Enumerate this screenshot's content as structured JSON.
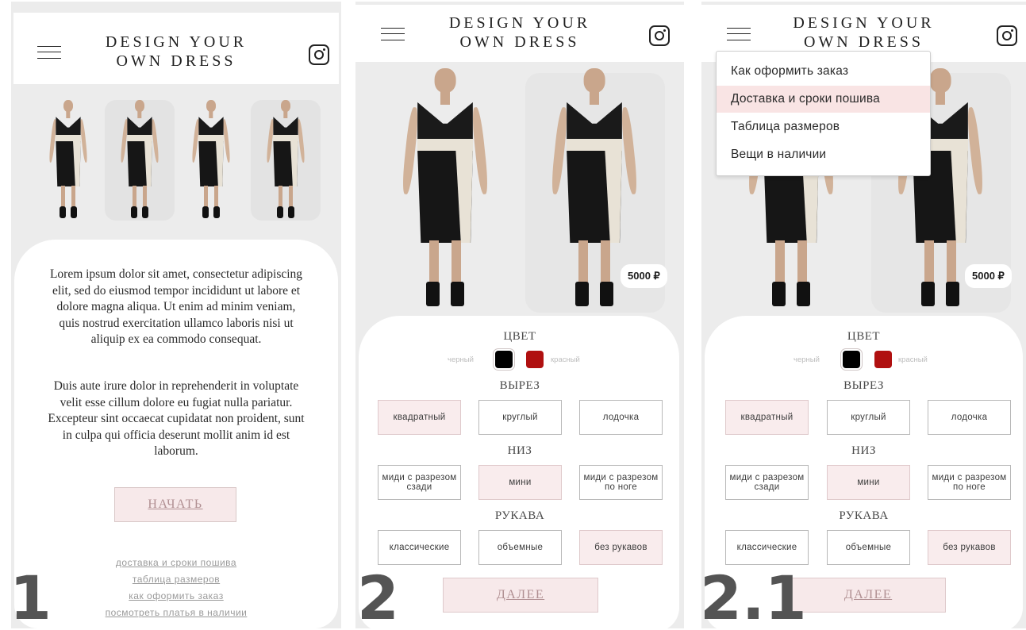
{
  "brand": {
    "logo_line1": "DESIGN YOUR",
    "logo_line2": "OWN DRESS"
  },
  "screen1": {
    "step_label": "1",
    "intro_p1": "Lorem ipsum dolor sit amet, consectetur adipiscing elit, sed do eiusmod tempor incididunt ut labore et dolore magna aliqua. Ut enim ad minim veniam, quis nostrud exercitation ullamco laboris nisi ut aliquip ex ea commodo consequat.",
    "intro_p2": "Duis aute irure dolor in reprehenderit in voluptate velit esse cillum dolore eu fugiat nulla pariatur. Excepteur sint occaecat cupidatat non proident, sunt in culpa qui officia deserunt mollit anim id est laborum.",
    "start_button": "НАЧАТЬ",
    "footer_links": [
      "доставка и сроки пошива",
      "таблица размеров",
      "как оформить заказ",
      "посмотреть платья в наличии"
    ]
  },
  "configurator": {
    "price": "5000 ₽",
    "color_title": "ЦВЕТ",
    "color_black": "черный",
    "color_red": "красный",
    "neckline_title": "ВЫРЕЗ",
    "neckline_options": [
      "квадратный",
      "круглый",
      "лодочка"
    ],
    "bottom_title": "НИЗ",
    "bottom_options": [
      "миди с разрезом сзади",
      "мини",
      "миди с разрезом по ноге"
    ],
    "sleeves_title": "РУКАВА",
    "sleeve_options": [
      "классические",
      "объемные",
      "без рукавов"
    ],
    "next_button": "ДАЛЕЕ"
  },
  "screen2": {
    "step_label": "2"
  },
  "screen3": {
    "step_label": "2.1",
    "menu_items": [
      "Как оформить заказ",
      "Доставка и сроки пошива",
      "Таблица размеров",
      "Вещи в наличии"
    ]
  },
  "colors": {
    "accent_pink": "#f7e9ea",
    "red_swatch": "#b01010",
    "black_swatch": "#000000"
  }
}
